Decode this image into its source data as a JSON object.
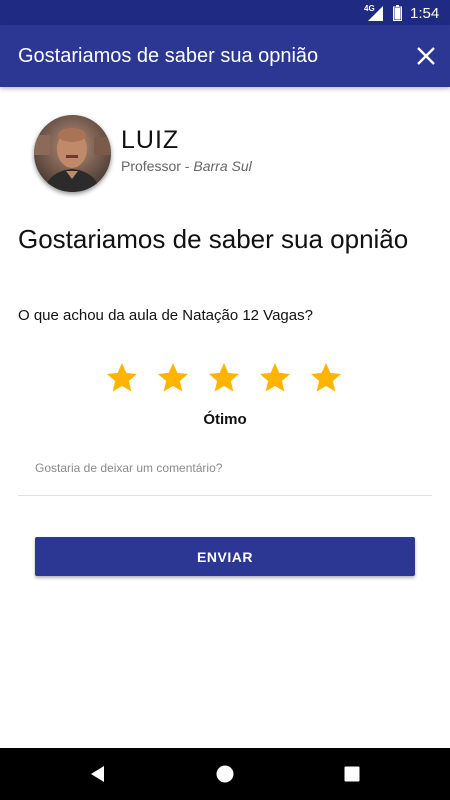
{
  "status_bar": {
    "network": "4G",
    "time": "1:54"
  },
  "app_bar": {
    "title": "Gostariamos de saber sua opnião",
    "close_icon": "close-icon"
  },
  "professor": {
    "name": "LUIZ",
    "role": "Professor",
    "separator": " - ",
    "location": "Barra Sul",
    "avatar_icon": "avatar-photo"
  },
  "form": {
    "heading": "Gostariamos de saber sua opnião",
    "question": "O que achou da aula de Natação 12 Vagas?",
    "rating": {
      "value": 5,
      "max": 5,
      "label": "Ótimo",
      "star_color": "#ffb400"
    },
    "comment": {
      "placeholder": "Gostaria de deixar um comentário?",
      "value": ""
    },
    "submit_label": "ENVIAR"
  },
  "colors": {
    "primary": "#2b3793",
    "status_bar": "#1f2a82"
  },
  "nav_bar": {
    "back_icon": "back-icon",
    "home_icon": "home-icon",
    "recents_icon": "recents-icon"
  }
}
